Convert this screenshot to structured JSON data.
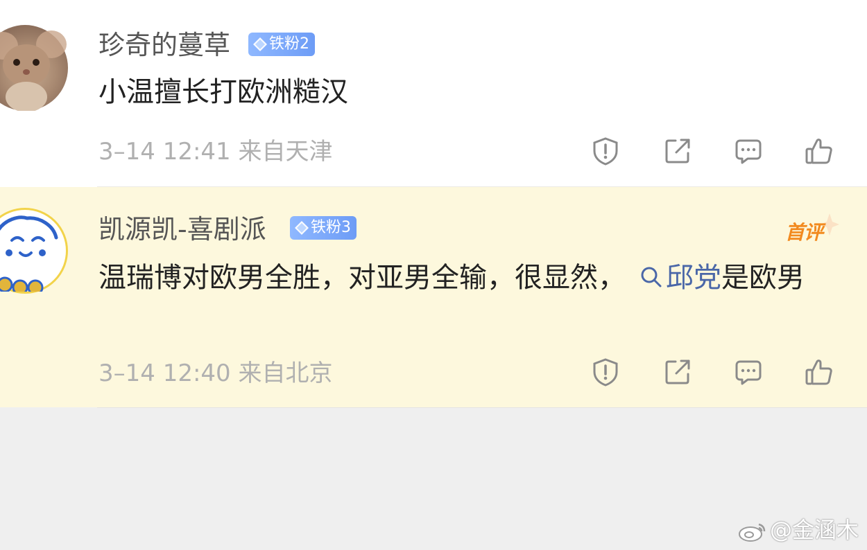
{
  "comments": [
    {
      "username": "珍奇的蔓草",
      "badge": "铁粉2",
      "text": "小温擅长打欧洲糙汉",
      "meta": "3–14 12:41  来自天津"
    },
    {
      "username": "凯源凯-喜剧派",
      "badge": "铁粉3",
      "tag": "首评",
      "text_before": "温瑞博对欧男全胜，对亚男全输，很显然，",
      "search_term": "邱党",
      "text_after": "是欧男",
      "meta": "3–14 12:40  来自北京"
    }
  ],
  "icons": [
    "report-icon",
    "share-icon",
    "reply-icon",
    "like-icon"
  ],
  "watermark": "@金涵木",
  "colors": {
    "first_comment_bg": "#ffffff",
    "highlight_bg": "#fdf8dd",
    "page_bg": "#efefef",
    "badge": "#7aa6f8",
    "first_tag": "#f28a1f",
    "search_link": "#4a67a8"
  }
}
